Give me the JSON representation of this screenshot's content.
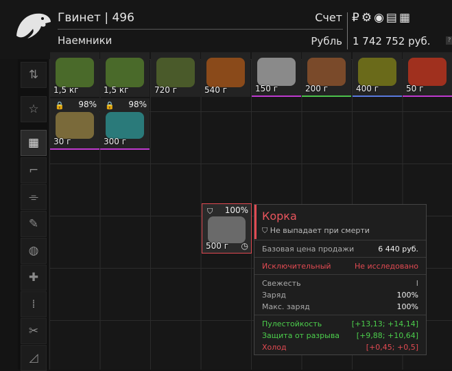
{
  "header": {
    "player_name": "Гвинет | 496",
    "faction": "Наемники",
    "account_label": "Счет",
    "currency_label": "Рубль",
    "currency_symbol": "₽",
    "money": "1 742 752 руб.",
    "help_label": "?"
  },
  "sidebar": {
    "items": [
      {
        "icon": "sort-icon"
      },
      {
        "icon": "favorite-icon"
      },
      {
        "icon": "all-items-icon",
        "active": true
      },
      {
        "icon": "weapons-icon"
      },
      {
        "icon": "weapon-parts-icon"
      },
      {
        "icon": "gear-icon"
      },
      {
        "icon": "barter-icon"
      },
      {
        "icon": "medical-icon"
      },
      {
        "icon": "ammo-icon"
      },
      {
        "icon": "tools-icon"
      },
      {
        "icon": "ruler-icon"
      }
    ]
  },
  "items": [
    {
      "weight": "1,5 кг",
      "color": "#4a6a2a",
      "border": "#c8c8c8"
    },
    {
      "weight": "1,5 кг",
      "color": "#4a6a2a",
      "border": "#c8c8c8"
    },
    {
      "weight": "720 г",
      "color": "#4a5a2a",
      "border": "#c8c8c8"
    },
    {
      "weight": "540 г",
      "color": "#8a4a1a",
      "border": "#c8c8c8"
    },
    {
      "weight": "150 г",
      "color": "#8a8a8a",
      "border": "#c03ad0"
    },
    {
      "weight": "200 г",
      "color": "#7a4a2a",
      "border": "#4cc44c"
    },
    {
      "weight": "400 г",
      "color": "#6a6a1a",
      "border": "#5a7ae0"
    },
    {
      "weight": "50 г",
      "color": "#a0301e",
      "border": "#c03ad0"
    },
    {
      "weight": "30 г",
      "percent": "98%",
      "locked": true,
      "color": "#7a6a3a",
      "border": "#c03ad0"
    },
    {
      "weight": "300 г",
      "percent": "98%",
      "locked": true,
      "color": "#2a7a7a",
      "border": "#c03ad0"
    },
    {
      "weight": "500 г",
      "percent": "100%",
      "locked": false,
      "color": "#7a7a7a",
      "border": "#e24a52"
    }
  ],
  "tooltip": {
    "title": "Корка",
    "no_drop": "Не выпадает при смерти",
    "price_label": "Базовая цена продажи",
    "price_value": "6 440 руб.",
    "rarity": "Исключительный",
    "research": "Не исследовано",
    "freshness_label": "Свежесть",
    "freshness_value": "I",
    "charge_label": "Заряд",
    "charge_value": "100%",
    "max_charge_label": "Макс. заряд",
    "max_charge_value": "100%",
    "stats": [
      {
        "label": "Пулестойкость",
        "value": "[+13,13; +14,14]",
        "color": "#4ccf4c"
      },
      {
        "label": "Защита от разрыва",
        "value": "[+9,88; +10,64]",
        "color": "#4ccf4c"
      },
      {
        "label": "Холод",
        "value": "[+0,45; +0,5]",
        "color": "#e24a52"
      }
    ]
  }
}
